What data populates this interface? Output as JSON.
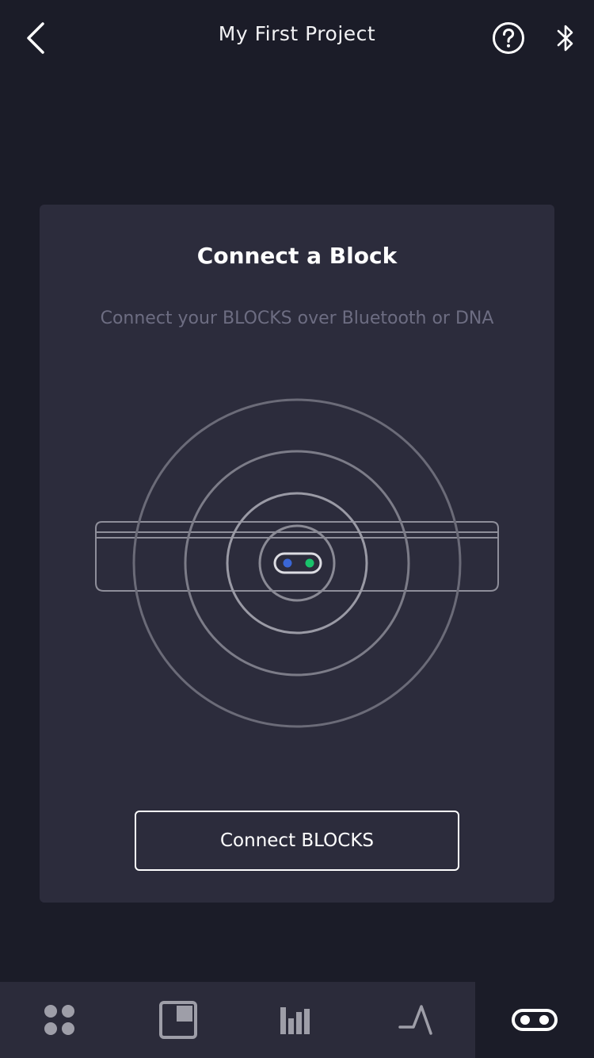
{
  "header": {
    "title": "My First Project",
    "icons": {
      "back": "chevron-left-icon",
      "help": "question-circle-icon",
      "bluetooth": "bluetooth-icon"
    }
  },
  "card": {
    "title": "Connect a Block",
    "subtitle": "Connect your BLOCKS over Bluetooth or DNA",
    "button_label": "Connect BLOCKS",
    "illustration": {
      "icon": "block-bluetooth-signal-illustration",
      "led_colors": [
        "#3a66d6",
        "#19c26b"
      ]
    }
  },
  "tabbar": {
    "tabs": [
      {
        "icon": "four-dots-grid-icon",
        "active": false
      },
      {
        "icon": "note-grid-icon",
        "active": false
      },
      {
        "icon": "mixer-bars-icon",
        "active": false
      },
      {
        "icon": "envelope-curve-icon",
        "active": false
      },
      {
        "icon": "block-device-icon",
        "active": true
      }
    ]
  },
  "colors": {
    "background": "#1b1c28",
    "card": "#2c2c3c",
    "tabbar": "#2b2b3a",
    "muted_text": "#6d6d82",
    "icon_gray": "#9e9ea8"
  }
}
